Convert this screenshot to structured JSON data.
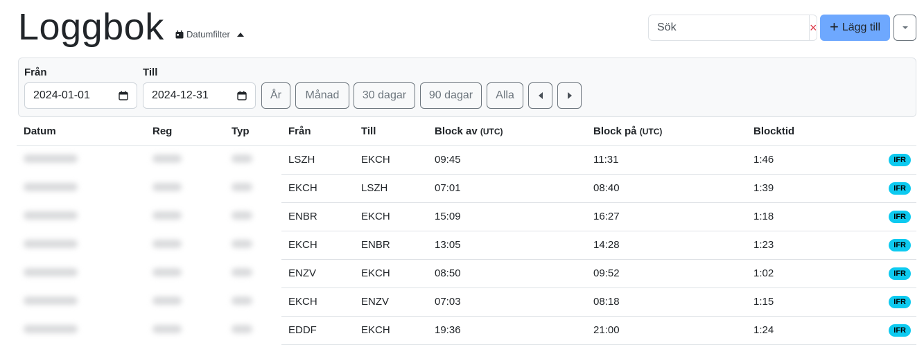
{
  "page": {
    "title": "Loggbok",
    "date_filter_label": "Datumfilter"
  },
  "search": {
    "placeholder": "Sök",
    "clear_icon": "×"
  },
  "toolbar": {
    "add_label": "Lägg till"
  },
  "filter": {
    "from_label": "Från",
    "from_value": "2024-01-01",
    "to_label": "Till",
    "to_value": "2024-12-31",
    "quick_buttons": [
      "År",
      "Månad",
      "30 dagar",
      "90 dagar",
      "Alla"
    ]
  },
  "table": {
    "headers": {
      "date": "Datum",
      "reg": "Reg",
      "type": "Typ",
      "from": "Från",
      "to": "Till",
      "block_off": "Block av",
      "block_on": "Block på",
      "utc": "(UTC)",
      "block_time": "Blocktid"
    },
    "rows": [
      {
        "from": "LSZH",
        "to": "EKCH",
        "off": "09:45",
        "on": "11:31",
        "time": "1:46",
        "rules": "IFR"
      },
      {
        "from": "EKCH",
        "to": "LSZH",
        "off": "07:01",
        "on": "08:40",
        "time": "1:39",
        "rules": "IFR"
      },
      {
        "from": "ENBR",
        "to": "EKCH",
        "off": "15:09",
        "on": "16:27",
        "time": "1:18",
        "rules": "IFR"
      },
      {
        "from": "EKCH",
        "to": "ENBR",
        "off": "13:05",
        "on": "14:28",
        "time": "1:23",
        "rules": "IFR"
      },
      {
        "from": "ENZV",
        "to": "EKCH",
        "off": "08:50",
        "on": "09:52",
        "time": "1:02",
        "rules": "IFR"
      },
      {
        "from": "EKCH",
        "to": "ENZV",
        "off": "07:03",
        "on": "08:18",
        "time": "1:15",
        "rules": "IFR"
      },
      {
        "from": "EDDF",
        "to": "EKCH",
        "off": "19:36",
        "on": "21:00",
        "time": "1:24",
        "rules": "IFR"
      }
    ]
  },
  "colors": {
    "primary_button": "#6ea8fe",
    "badge": "#0dcaf0",
    "clear": "#dc3545",
    "panel_bg": "#f8f9fa"
  }
}
